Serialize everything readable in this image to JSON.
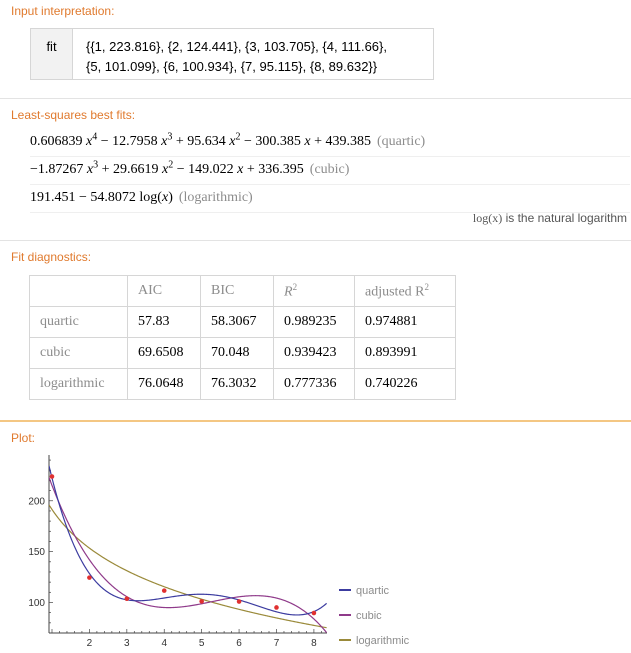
{
  "input": {
    "title": "Input interpretation:",
    "label": "fit",
    "line1": "{{1, 223.816}, {2, 124.441}, {3, 103.705}, {4, 111.66},",
    "line2": "{5, 101.099}, {6, 100.934}, {7, 95.115}, {8, 89.632}}"
  },
  "fits": {
    "title": "Least-squares best fits:",
    "quartic": {
      "c4": "0.606839",
      "c3": "12.7958",
      "c2": "95.634",
      "c1": "300.385",
      "c0": "439.385",
      "kind": "(quartic)"
    },
    "cubic": {
      "c3": "−1.87267",
      "c2": "29.6619",
      "c1": "149.022",
      "c0": "336.395",
      "kind": "(cubic)"
    },
    "logarithmic": {
      "a": "191.451",
      "b": "54.8072",
      "kind": "(logarithmic)"
    },
    "note_pre": "log",
    "note_arg": "(x)",
    "note_post": "is the natural logarithm"
  },
  "diagnostics": {
    "title": "Fit diagnostics:",
    "headers": [
      "AIC",
      "BIC",
      "R",
      "adjusted R"
    ],
    "rows": [
      {
        "name": "quartic",
        "aic": "57.83",
        "bic": "58.3067",
        "r2": "0.989235",
        "adj": "0.974881"
      },
      {
        "name": "cubic",
        "aic": "69.6508",
        "bic": "70.048",
        "r2": "0.939423",
        "adj": "0.893991"
      },
      {
        "name": "logarithmic",
        "aic": "76.0648",
        "bic": "76.3032",
        "r2": "0.777336",
        "adj": "0.740226"
      }
    ]
  },
  "plot": {
    "title": "Plot:",
    "legend": [
      "quartic",
      "cubic",
      "logarithmic"
    ]
  },
  "colors": {
    "pod_title": "#e07a2e",
    "quartic": "#3c3ca0",
    "cubic": "#8f3a8a",
    "logarithmic": "#9a8a3a",
    "points": "#e03030"
  },
  "chart_data": {
    "type": "scatter",
    "x": [
      1,
      2,
      3,
      4,
      5,
      6,
      7,
      8
    ],
    "y": [
      223.816,
      124.441,
      103.705,
      111.66,
      101.099,
      100.934,
      95.115,
      89.632
    ],
    "xticks": [
      2,
      3,
      4,
      5,
      6,
      7,
      8
    ],
    "yticks": [
      100,
      150,
      200
    ],
    "xlim": [
      0.92,
      8.35
    ],
    "ylim": [
      70,
      245
    ],
    "series": [
      {
        "name": "quartic",
        "coefficients": [
          439.385,
          -300.385,
          95.634,
          -12.7958,
          0.606839
        ]
      },
      {
        "name": "cubic",
        "coefficients": [
          336.395,
          -149.022,
          29.6619,
          -1.87267
        ]
      },
      {
        "name": "logarithmic",
        "a": 191.451,
        "b": -54.8072
      }
    ],
    "legend_position": "right"
  }
}
